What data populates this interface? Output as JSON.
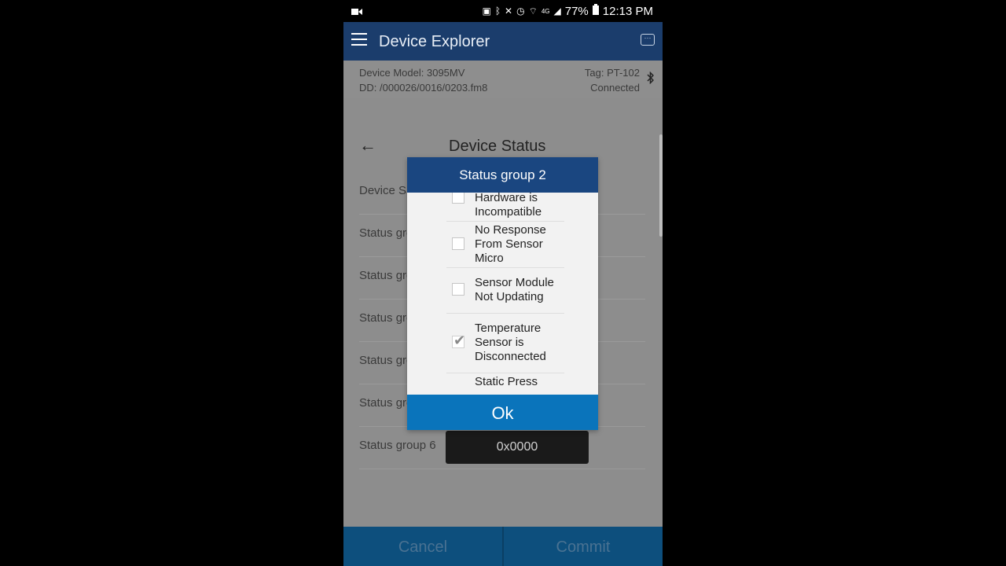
{
  "status_bar": {
    "battery": "77%",
    "time": "12:13 PM",
    "network": "4G"
  },
  "app_bar": {
    "title": "Device Explorer"
  },
  "device_info": {
    "model_label": "Device Model:  3095MV",
    "dd_label": "DD:  /000026/0016/0203.fm8",
    "tag_label": "Tag:  PT-102",
    "connection_status": "Connected"
  },
  "page": {
    "title": "Device Status",
    "rows": [
      {
        "label": "Device S"
      },
      {
        "label": "Status gro"
      },
      {
        "label": "Status gro"
      },
      {
        "label": "Status gro"
      },
      {
        "label": "Status gro"
      },
      {
        "label": "Status gro"
      },
      {
        "label": "Status group 6"
      }
    ],
    "visible_value": "0x0000"
  },
  "dialog": {
    "title": "Status group 2",
    "items": [
      {
        "text": "Hardware is Incompatible",
        "checked": false
      },
      {
        "text": "No Response From Sensor Micro",
        "checked": false
      },
      {
        "text": "Sensor Module Not Updating",
        "checked": false
      },
      {
        "text": "Temperature Sensor is Disconnected",
        "checked": true
      },
      {
        "text": "Static Press",
        "checked": false
      }
    ],
    "ok_label": "Ok"
  },
  "bottom": {
    "cancel_label": "Cancel",
    "commit_label": "Commit"
  }
}
